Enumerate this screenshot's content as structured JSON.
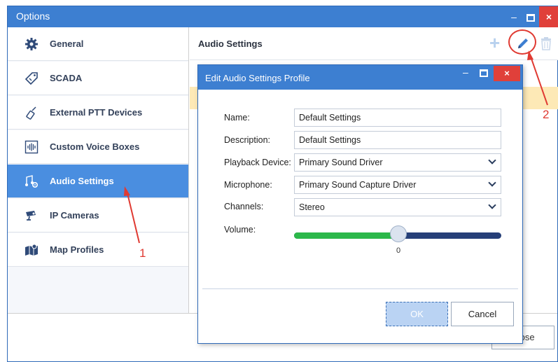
{
  "window": {
    "title": "Options",
    "min_glyph": "–",
    "close_glyph": "×",
    "close_button_label": "Close"
  },
  "sidebar": {
    "items": [
      {
        "label": "General",
        "icon": "gear-icon"
      },
      {
        "label": "SCADA",
        "icon": "tag-icon"
      },
      {
        "label": "External PTT Devices",
        "icon": "radio-icon"
      },
      {
        "label": "Custom Voice Boxes",
        "icon": "waveform-icon"
      },
      {
        "label": "Audio Settings",
        "icon": "audio-settings-icon",
        "active": true
      },
      {
        "label": "IP Cameras",
        "icon": "camera-icon"
      },
      {
        "label": "Map Profiles",
        "icon": "map-icon"
      }
    ]
  },
  "panel": {
    "title": "Audio Settings",
    "add_glyph": "+"
  },
  "annotations": {
    "num1": "1",
    "num2": "2",
    "color": "#e03a32"
  },
  "dialog": {
    "title": "Edit Audio Settings Profile",
    "min_glyph": "–",
    "close_glyph": "×",
    "fields": {
      "name": {
        "label": "Name:",
        "value": "Default Settings"
      },
      "description": {
        "label": "Description:",
        "value": "Default Settings"
      },
      "playback": {
        "label": "Playback Device:",
        "value": "Primary Sound Driver"
      },
      "microphone": {
        "label": "Microphone:",
        "value": "Primary Sound Capture Driver"
      },
      "channels": {
        "label": "Channels:",
        "value": "Stereo"
      }
    },
    "volume": {
      "label": "Volume:",
      "value": "0",
      "fill_fraction": 0.5
    },
    "ok_label": "OK",
    "cancel_label": "Cancel"
  },
  "colors": {
    "accent": "#3d7fd1",
    "active_item": "#4a8ee0",
    "close_red": "#e0403a",
    "highlight_row": "#fde9b6",
    "slider_green": "#2cb84a",
    "slider_navy": "#263f78"
  }
}
